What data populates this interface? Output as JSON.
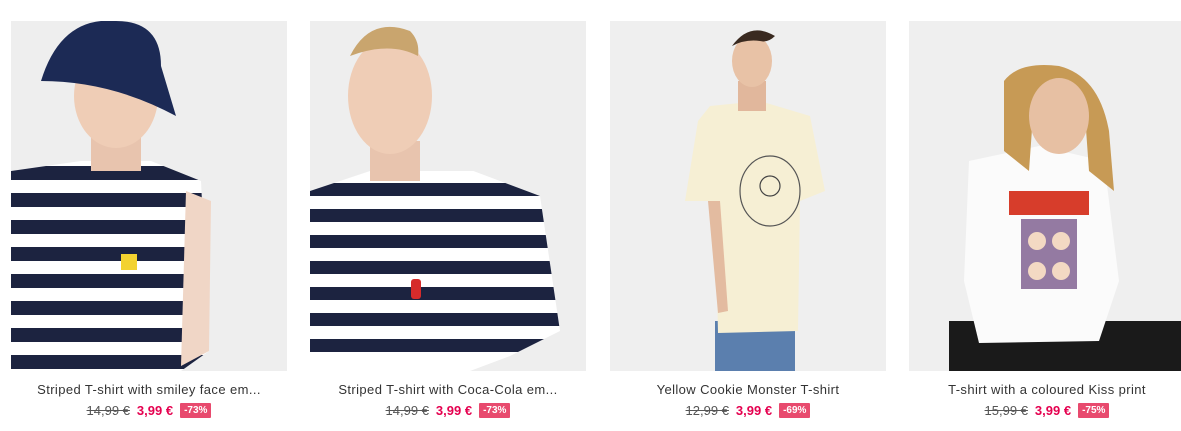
{
  "colors": {
    "sale": "#e5004f",
    "badge_bg": "#e84a6e"
  },
  "products": [
    {
      "title": "Striped T-shirt with smiley face em...",
      "old_price": "14,99 €",
      "new_price": "3,99 €",
      "discount": "-73%",
      "image": "model-striped-tshirt-bucket-hat"
    },
    {
      "title": "Striped T-shirt with Coca-Cola em...",
      "old_price": "14,99 €",
      "new_price": "3,99 €",
      "discount": "-73%",
      "image": "model-striped-tshirt"
    },
    {
      "title": "Yellow Cookie Monster T-shirt",
      "old_price": "12,99 €",
      "new_price": "3,99 €",
      "discount": "-69%",
      "image": "model-yellow-tshirt"
    },
    {
      "title": "T-shirt with a coloured Kiss print",
      "old_price": "15,99 €",
      "new_price": "3,99 €",
      "discount": "-75%",
      "image": "model-white-kiss-tshirt"
    }
  ]
}
